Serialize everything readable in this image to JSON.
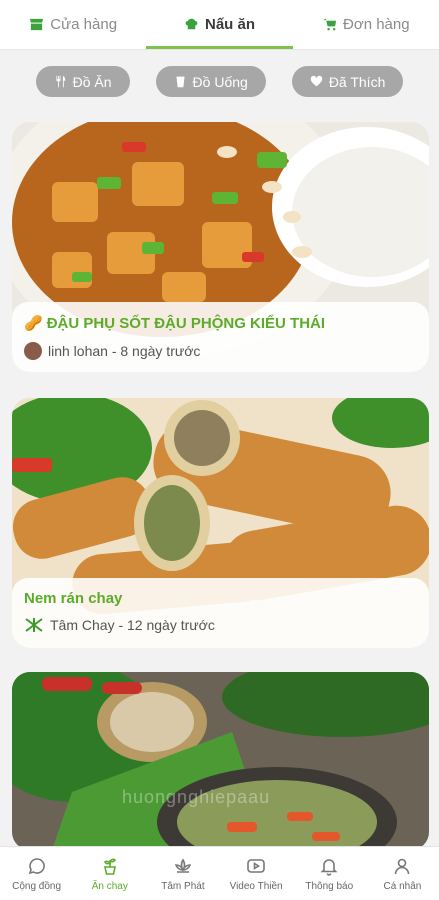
{
  "top_tabs": [
    {
      "label": "Cửa hàng",
      "icon": "shop-icon"
    },
    {
      "label": "Nấu ăn",
      "icon": "chef-hat-icon",
      "active": true
    },
    {
      "label": "Đơn hàng",
      "icon": "cart-icon"
    }
  ],
  "filters": [
    {
      "label": "Đồ Ăn",
      "icon": "fork-knife-icon"
    },
    {
      "label": "Đồ Uống",
      "icon": "cup-icon"
    },
    {
      "label": "Đã Thích",
      "icon": "heart-icon"
    }
  ],
  "recipes": [
    {
      "title": "ĐẬU PHỤ SỐT ĐẬU PHỘNG KIỂU THÁI",
      "title_emoji": "🥜",
      "author_line": "linh lohan - 8 ngày trước"
    },
    {
      "title": "Nem rán chay",
      "author_line": "Tâm Chay - 12 ngày trước"
    },
    {
      "watermark": "huongnghiepaau"
    }
  ],
  "bottom_nav": [
    {
      "label": "Cộng đồng",
      "icon": "chat-bubble-icon"
    },
    {
      "label": "Ăn chay",
      "icon": "plant-pot-icon",
      "active": true
    },
    {
      "label": "Tâm Phát",
      "icon": "lotus-icon"
    },
    {
      "label": "Video Thiền",
      "icon": "play-video-icon"
    },
    {
      "label": "Thông báo",
      "icon": "bell-icon"
    },
    {
      "label": "Cá nhân",
      "icon": "person-icon"
    }
  ],
  "colors": {
    "accent": "#5cab2b",
    "chip": "#a7a7a7",
    "tab_underline": "#7dc24b"
  }
}
